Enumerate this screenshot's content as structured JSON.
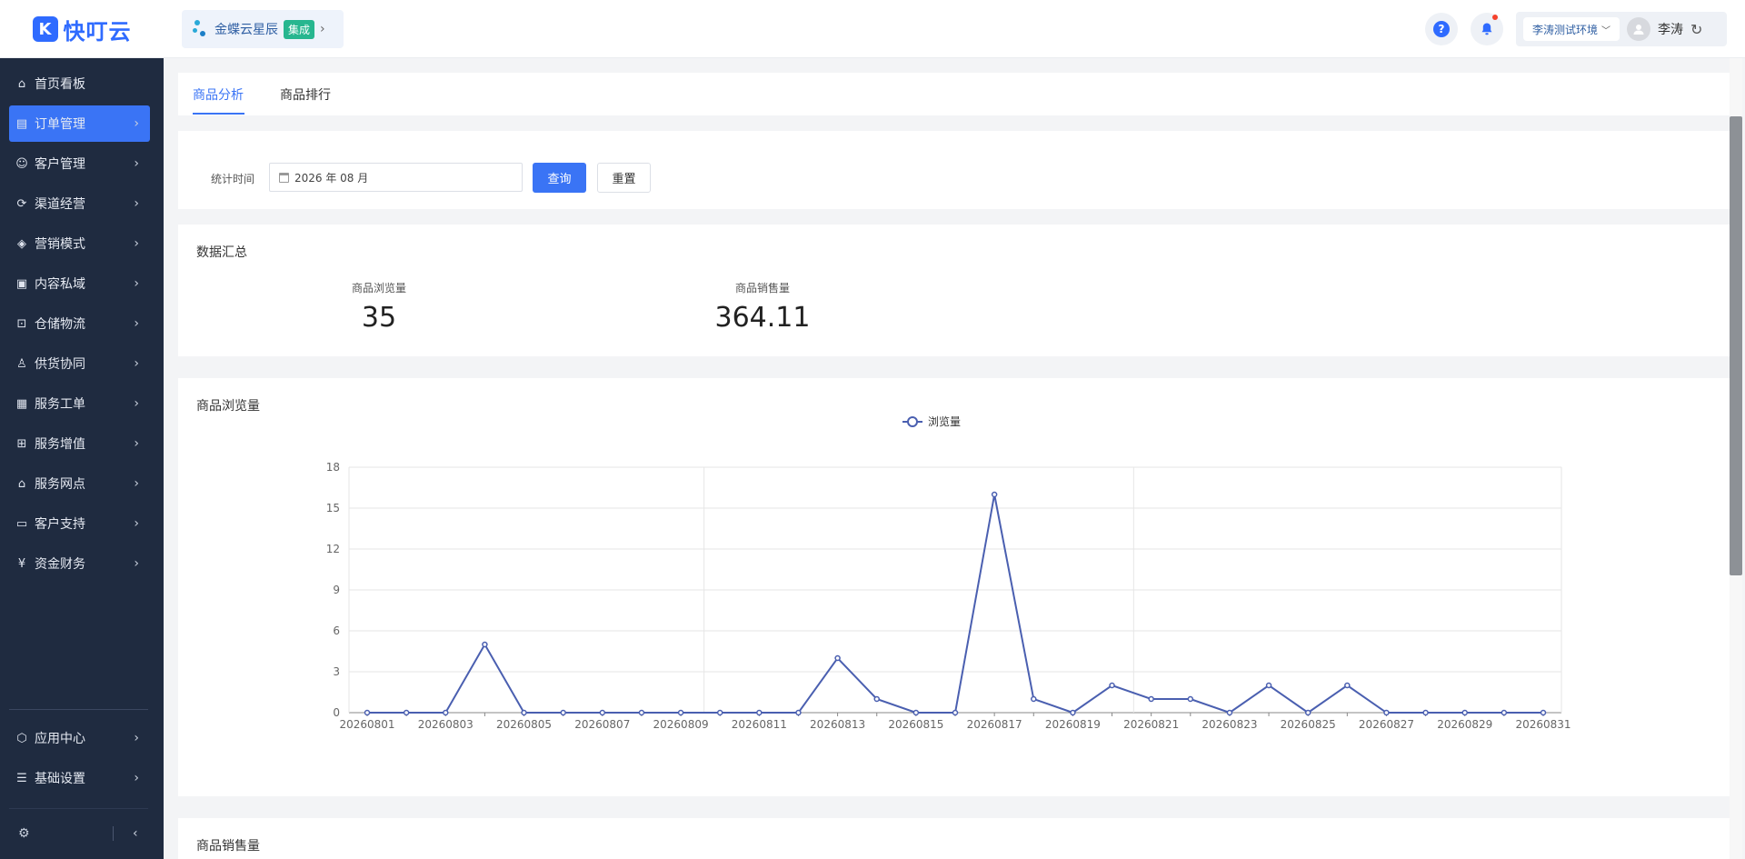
{
  "header": {
    "logo_mark": "K",
    "logo_text": "快叮云",
    "workspace_name": "金蝶云星辰",
    "workspace_badge": "集成",
    "help_label": "?",
    "env_label": "李涛测试环境",
    "user_name": "李涛"
  },
  "sidebar": {
    "items": [
      {
        "label": "首页看板",
        "icon": "home-icon",
        "glyph": "⌂"
      },
      {
        "label": "订单管理",
        "icon": "order-icon",
        "glyph": "▤"
      },
      {
        "label": "客户管理",
        "icon": "user-icon",
        "glyph": "☺"
      },
      {
        "label": "渠道经营",
        "icon": "channel-icon",
        "glyph": "⟳"
      },
      {
        "label": "营销模式",
        "icon": "tag-icon",
        "glyph": "◈"
      },
      {
        "label": "内容私域",
        "icon": "image-icon",
        "glyph": "▣"
      },
      {
        "label": "仓储物流",
        "icon": "warehouse-icon",
        "glyph": "⊡"
      },
      {
        "label": "供货协同",
        "icon": "supplier-icon",
        "glyph": "♙"
      },
      {
        "label": "服务工单",
        "icon": "ticket-icon",
        "glyph": "▦"
      },
      {
        "label": "服务增值",
        "icon": "bag-icon",
        "glyph": "⊞"
      },
      {
        "label": "服务网点",
        "icon": "store-icon",
        "glyph": "⌂"
      },
      {
        "label": "客户支持",
        "icon": "support-icon",
        "glyph": "▭"
      },
      {
        "label": "资金财务",
        "icon": "yuan-icon",
        "glyph": "¥"
      }
    ],
    "bottom_items": [
      {
        "label": "应用中心",
        "icon": "app-center-icon",
        "glyph": "⬡"
      },
      {
        "label": "基础设置",
        "icon": "settings-list-icon",
        "glyph": "☰"
      }
    ]
  },
  "tabs": [
    {
      "label": "商品分析",
      "active": true
    },
    {
      "label": "商品排行",
      "active": false
    }
  ],
  "filter": {
    "label": "统计时间",
    "date_value": "2026 年 08 月",
    "query_button": "查询",
    "reset_button": "重置"
  },
  "summary": {
    "title": "数据汇总",
    "stats": [
      {
        "label": "商品浏览量",
        "value": "35"
      },
      {
        "label": "商品销售量",
        "value": "364.11"
      }
    ]
  },
  "browse_chart": {
    "title": "商品浏览量"
  },
  "sales_chart": {
    "title": "商品销售量"
  },
  "colors": {
    "accent": "#3a74f5",
    "sidebar_bg": "#1f2b40",
    "line": "#4a5fb0"
  },
  "chart_data": {
    "type": "line",
    "legend": "浏览量",
    "legend_position": "top-center",
    "x": [
      "20260801",
      "20260802",
      "20260803",
      "20260804",
      "20260805",
      "20260806",
      "20260807",
      "20260808",
      "20260809",
      "20260810",
      "20260811",
      "20260812",
      "20260813",
      "20260814",
      "20260815",
      "20260816",
      "20260817",
      "20260818",
      "20260819",
      "20260820",
      "20260821",
      "20260822",
      "20260823",
      "20260824",
      "20260825",
      "20260826",
      "20260827",
      "20260828",
      "20260829",
      "20260830",
      "20260831"
    ],
    "x_tick_labels": [
      "20260801",
      "20260803",
      "20260805",
      "20260807",
      "20260809",
      "20260811",
      "20260813",
      "20260815",
      "20260817",
      "20260819",
      "20260821",
      "20260823",
      "20260825",
      "20260827",
      "20260829",
      "20260831"
    ],
    "series": [
      {
        "name": "浏览量",
        "values": [
          0,
          0,
          0,
          5,
          0,
          0,
          0,
          0,
          0,
          0,
          0,
          0,
          4,
          1,
          0,
          0,
          16,
          1,
          0,
          2,
          1,
          1,
          0,
          2,
          0,
          2,
          0,
          0,
          0,
          0,
          0
        ]
      }
    ],
    "y_ticks": [
      0,
      3,
      6,
      9,
      12,
      15,
      18
    ],
    "ylim": [
      0,
      18
    ],
    "grid": true
  }
}
